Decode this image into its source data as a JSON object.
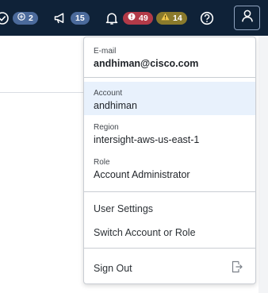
{
  "header": {
    "icons": {
      "check": "check-circle-icon",
      "add": "add-circle-icon",
      "announce": "megaphone-icon",
      "bell": "bell-icon",
      "error": "error-icon",
      "warning": "warning-icon",
      "help": "help-circle-icon",
      "profile": "user-icon"
    },
    "requests_count": "2",
    "announcements_count": "15",
    "critical_alarms_count": "49",
    "warning_alarms_count": "14",
    "colors": {
      "bar": "#0f2238",
      "critical": "#b23a48",
      "warning": "#8a7a2c",
      "info": "#3f6fb8"
    }
  },
  "profile_menu": {
    "email_label": "E-mail",
    "email_value": "andhiman@cisco.com",
    "account_label": "Account",
    "account_value": "andhiman",
    "region_label": "Region",
    "region_value": "intersight-aws-us-east-1",
    "role_label": "Role",
    "role_value": "Account Administrator",
    "user_settings": "User Settings",
    "switch_account": "Switch Account or Role",
    "sign_out": "Sign Out",
    "sign_out_icon": "sign-out-icon"
  }
}
